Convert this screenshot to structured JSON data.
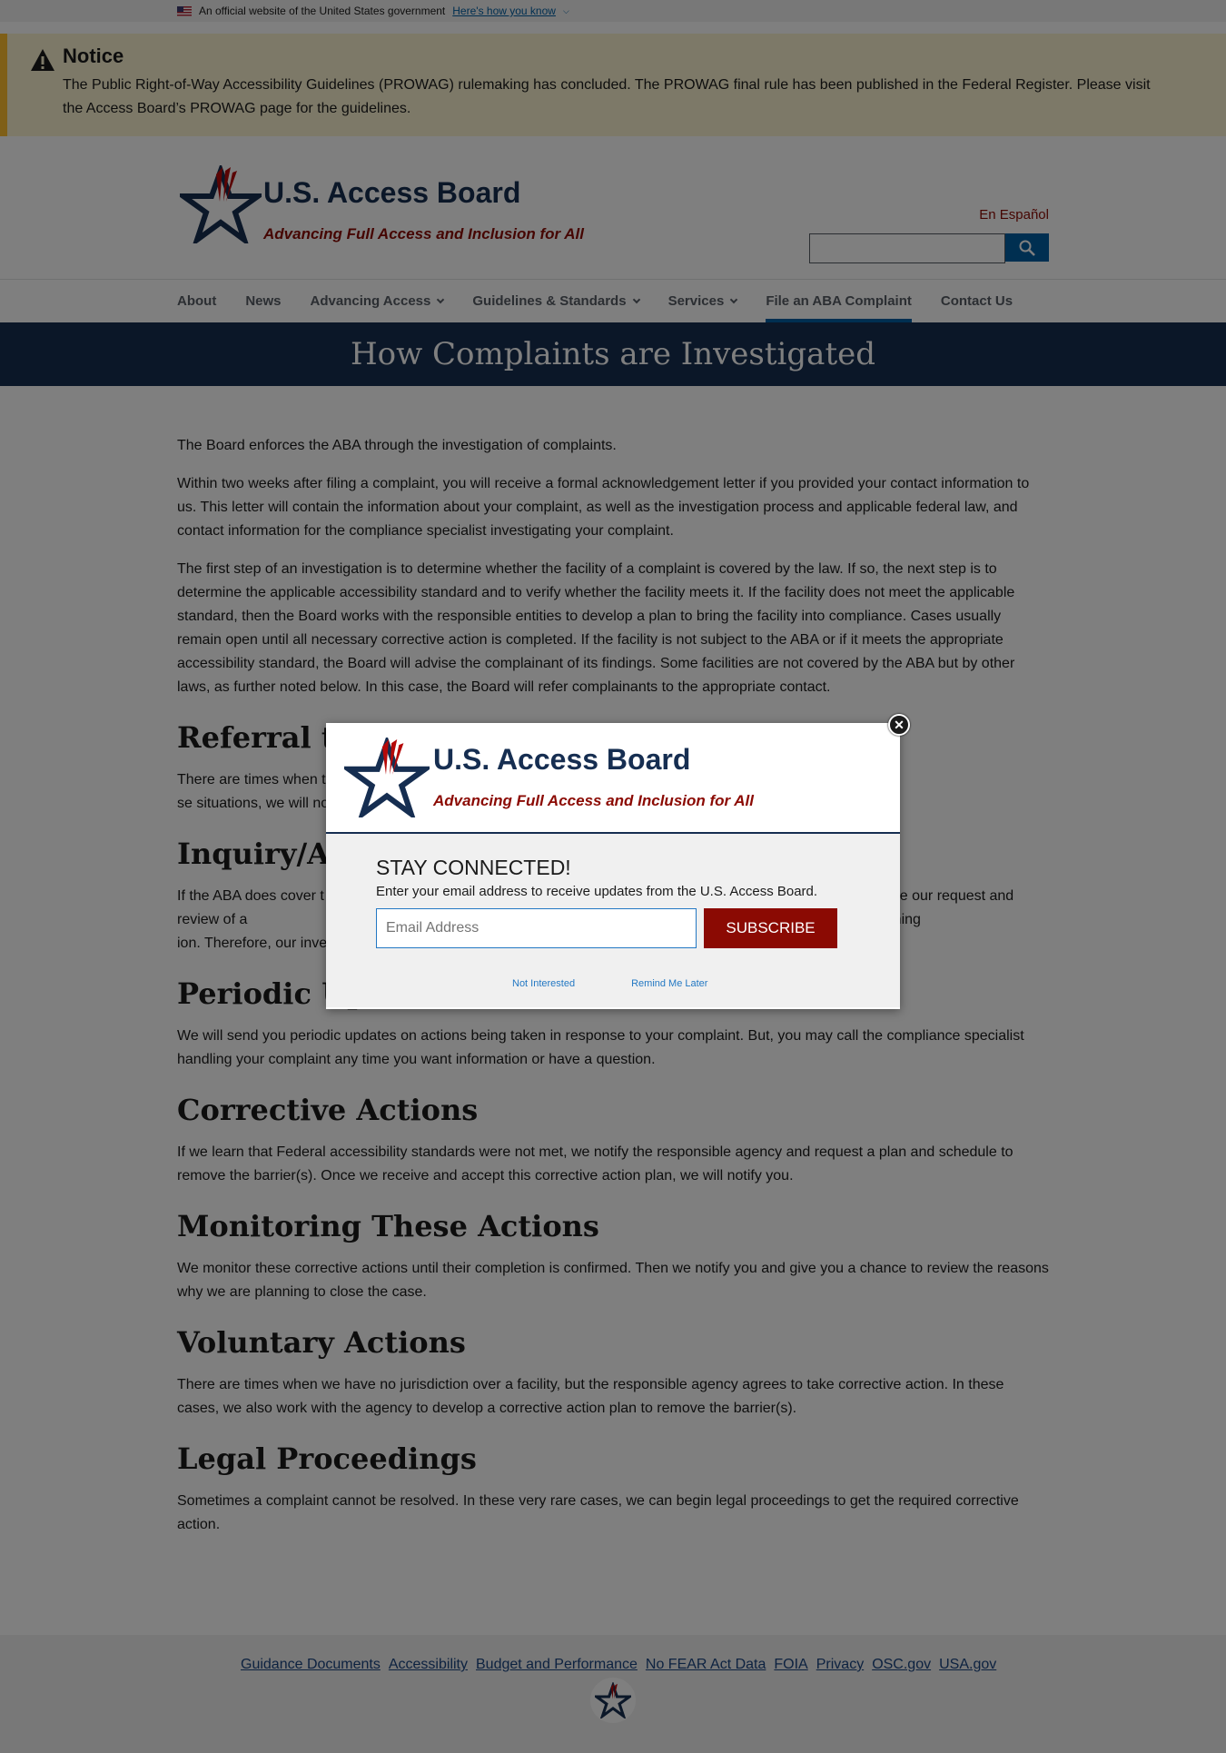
{
  "gov_banner": {
    "text": "An official website of the United States government",
    "link": "Here's how you know"
  },
  "notice": {
    "title": "Notice",
    "text": "The Public Right-of-Way Accessibility Guidelines (PROWAG) rulemaking has concluded. The PROWAG final rule has been published in the Federal Register. Please visit the Access Board’s PROWAG page for the guidelines."
  },
  "header": {
    "title": "U.S. Access Board",
    "tagline": "Advancing Full Access and Inclusion for All",
    "espanol": "En Español",
    "search_icon": "search-icon"
  },
  "nav": {
    "items": [
      {
        "label": "About",
        "dropdown": false
      },
      {
        "label": "News",
        "dropdown": false
      },
      {
        "label": "Advancing Access",
        "dropdown": true
      },
      {
        "label": "Guidelines & Standards",
        "dropdown": true
      },
      {
        "label": "Services",
        "dropdown": true
      },
      {
        "label": "File an ABA Complaint",
        "dropdown": false,
        "active": true
      },
      {
        "label": "Contact Us",
        "dropdown": false
      }
    ]
  },
  "page_title": "How Complaints are Investigated",
  "content": {
    "p1": "The Board enforces the ABA through the investigation of complaints.",
    "p2": "Within two weeks after filing a complaint, you will receive a formal acknowledgement letter if you provided your contact information to us. This letter will contain the information about your complaint, as well as the investigation process and applicable federal law, and contact information for the compliance specialist investigating your complaint.",
    "p3": "The first step of an investigation is to determine whether the facility of a complaint is covered by the law. If so, the next step is to determine the applicable accessibility standard and to verify whether the facility meets it. If the facility does not meet the applicable standard, then the Board works with the responsible entities to develop a plan to bring the facility into compliance. Cases usually remain open until all necessary corrective action is completed. If the facility is not subject to the ABA or if it meets the appropriate accessibility standard, the Board will advise the complainant of its findings. Some facilities are not covered by the ABA but by other laws, as further noted below. In this case, the Board will refer complainants to the appropriate contact.",
    "h_referral": "Referral to",
    "p_referral": "There are times when t                                                                                                                                                                                   se situations, we will not open a case but wil",
    "h_inquiry": "Inquiry/An",
    "p_inquiry": "If the ABA does cover t                                                                                                                          is may involve our request and review of a                                                                                                  d a very small staff located only in Washing                                                                                          ion. Therefore, our investigations may take",
    "h_periodic": "Periodic Updates",
    "p_periodic": "We will send you periodic updates on actions being taken in response to your complaint. But, you may call the compliance specialist handling your complaint any time you want information or have a question.",
    "h_corrective": "Corrective Actions",
    "p_corrective": "If we learn that Federal accessibility standards were not met, we notify the responsible agency and request a plan and schedule to remove the barrier(s). Once we receive and accept this corrective action plan, we will notify you.",
    "h_monitoring": "Monitoring These Actions",
    "p_monitoring": "We monitor these corrective actions until their completion is confirmed. Then we notify you and give you a chance to review the reasons why we are planning to close the case.",
    "h_voluntary": "Voluntary Actions",
    "p_voluntary": "There are times when we have no jurisdiction over a facility, but the responsible agency agrees to take corrective action. In these cases, we also work with the agency to develop a corrective action plan to remove the barrier(s).",
    "h_legal": "Legal Proceedings",
    "p_legal": "Sometimes a complaint cannot be resolved. In these very rare cases, we can begin legal proceedings to get the required corrective action."
  },
  "footer": {
    "links": [
      "Guidance Documents",
      "Accessibility",
      "Budget and Performance",
      "No FEAR Act Data",
      "FOIA",
      "Privacy",
      "OSC.gov",
      "USA.gov"
    ]
  },
  "modal": {
    "title": "U.S. Access Board",
    "tagline": "Advancing Full Access and Inclusion for All",
    "heading": "STAY CONNECTED!",
    "description": "Enter your email address to receive updates from the U.S. Access Board.",
    "email_placeholder": "Email Address",
    "subscribe": "SUBSCRIBE",
    "not_interested": "Not Interested",
    "remind_later": "Remind Me Later",
    "close_icon": "close-icon"
  }
}
